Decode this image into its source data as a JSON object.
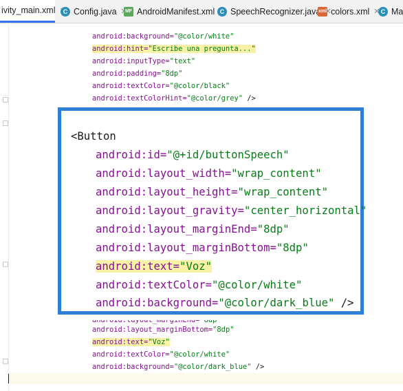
{
  "tabs": [
    {
      "label": "ivity_main.xml",
      "icon": "none",
      "active": true
    },
    {
      "label": "Config.java",
      "icon": "java-class-icon",
      "active": false
    },
    {
      "label": "AndroidManifest.xml",
      "icon": "manifest-icon",
      "active": false
    },
    {
      "label": "SpeechRecognizer.java",
      "icon": "java-class-icon",
      "active": false
    },
    {
      "label": "colors.xml",
      "icon": "xml-resource-icon",
      "active": false
    },
    {
      "label": "Mai",
      "icon": "java-class-icon",
      "active": false
    }
  ],
  "background_code": [
    {
      "attr": "android:background=",
      "value": "\"@color/white\"",
      "tail": ""
    },
    {
      "attr": "android:hint=",
      "value": "\"Escribe una pregunta...\"",
      "tail": "",
      "highlight": true
    },
    {
      "attr": "android:inputType=",
      "value": "\"text\"",
      "tail": ""
    },
    {
      "attr": "android:padding=",
      "value": "\"8dp\"",
      "tail": ""
    },
    {
      "attr": "android:textColor=",
      "value": "\"@color/black\"",
      "tail": ""
    },
    {
      "attr": "android:textColorHint=",
      "value": "\"@color/grey\"",
      "tail": " />"
    }
  ],
  "lower_code": [
    {
      "attr": "android:layout_marginEnd=",
      "value": "\"8dp\"",
      "tail": ""
    },
    {
      "attr": "android:layout_marginBottom=",
      "value": "\"8dp\"",
      "tail": ""
    },
    {
      "attr": "android:text=",
      "value": "\"Voz\"",
      "tail": "",
      "highlight": true
    },
    {
      "attr": "android:textColor=",
      "value": "\"@color/white\"",
      "tail": ""
    },
    {
      "attr": "android:background=",
      "value": "\"@color/dark_blue\"",
      "tail": " />"
    }
  ],
  "zoom_panel": {
    "tag": "<Button",
    "lines": [
      {
        "attr": "android:id=",
        "value": "\"@+id/buttonSpeech\"",
        "tail": ""
      },
      {
        "attr": "android:layout_width=",
        "value": "\"wrap_content\"",
        "tail": ""
      },
      {
        "attr": "android:layout_height=",
        "value": "\"wrap_content\"",
        "tail": ""
      },
      {
        "attr": "android:layout_gravity=",
        "value": "\"center_horizontal\"",
        "tail": ""
      },
      {
        "attr": "android:layout_marginEnd=",
        "value": "\"8dp\"",
        "tail": ""
      },
      {
        "attr": "android:layout_marginBottom=",
        "value": "\"8dp\"",
        "tail": ""
      },
      {
        "attr": "android:text=",
        "value": "\"Voz\"",
        "tail": "",
        "highlight": true
      },
      {
        "attr": "android:textColor=",
        "value": "\"@color/white\"",
        "tail": ""
      },
      {
        "attr": "android:background=",
        "value": "\"@color/dark_blue\"",
        "tail": " />"
      }
    ]
  },
  "colors": {
    "attribute": "#871094",
    "string_value": "#067d17",
    "highlight": "#f7f2a6",
    "zoom_border": "#2f7fd6",
    "active_tab_underline": "#3574f0"
  }
}
